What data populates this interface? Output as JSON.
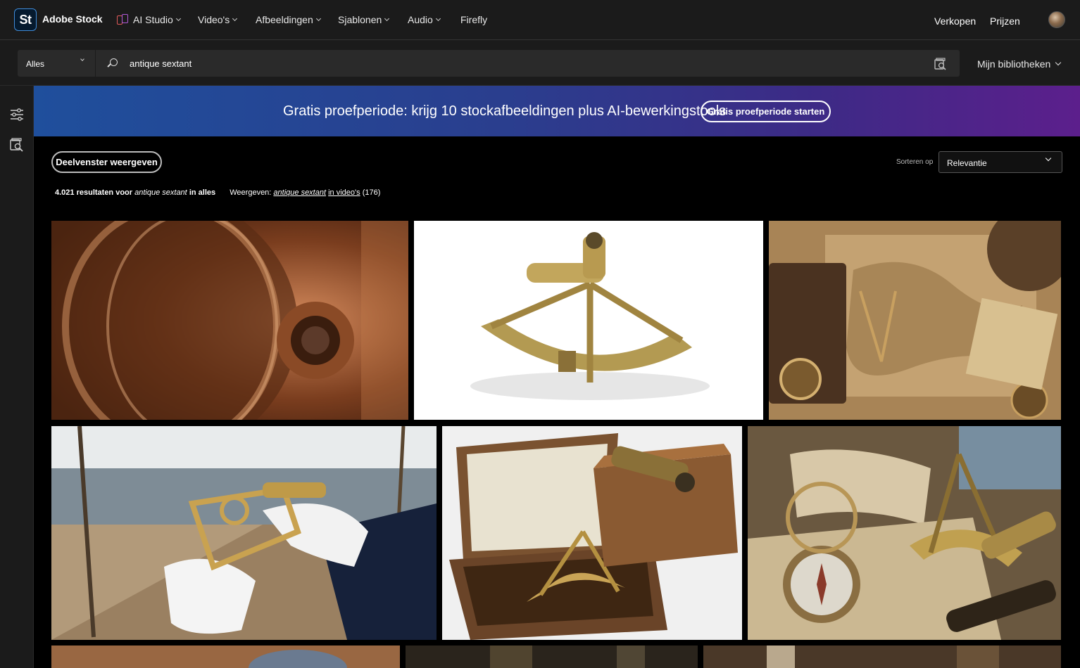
{
  "brand": {
    "logo": "St",
    "name": "Adobe Stock"
  },
  "nav": {
    "items": [
      {
        "label": "AI Studio"
      },
      {
        "label": "Video's"
      },
      {
        "label": "Afbeeldingen"
      },
      {
        "label": "Sjablonen"
      },
      {
        "label": "Audio"
      },
      {
        "label": "Firefly"
      }
    ],
    "sell": "Verkopen",
    "pricing": "Prijzen"
  },
  "search": {
    "scope": "Alles",
    "query": "antique sextant",
    "libraries": "Mijn bibliotheken"
  },
  "banner": {
    "text": "Gratis proefperiode: krijg 10 stockafbeeldingen plus AI-bewerkingstools",
    "button": "Gratis proefperiode starten"
  },
  "toolbar": {
    "panel_button": "Deelvenster weergeven",
    "sort_label": "Sorteren op",
    "sort_value": "Relevantie"
  },
  "results": {
    "count": "4.021 resultaten voor",
    "query": "antique sextant",
    "scope_prefix": "in",
    "scope": "alles",
    "view_label": "Weergeven:",
    "video_query": "antique sextant",
    "video_suffix": "in video's",
    "video_count": "(176)"
  },
  "colors": {
    "nav_bg": "#1b1b1b",
    "page_bg": "#000000",
    "banner_start": "#1f4f9c",
    "banner_end": "#5c1f8c",
    "logo_accent": "#3f8bd9"
  }
}
